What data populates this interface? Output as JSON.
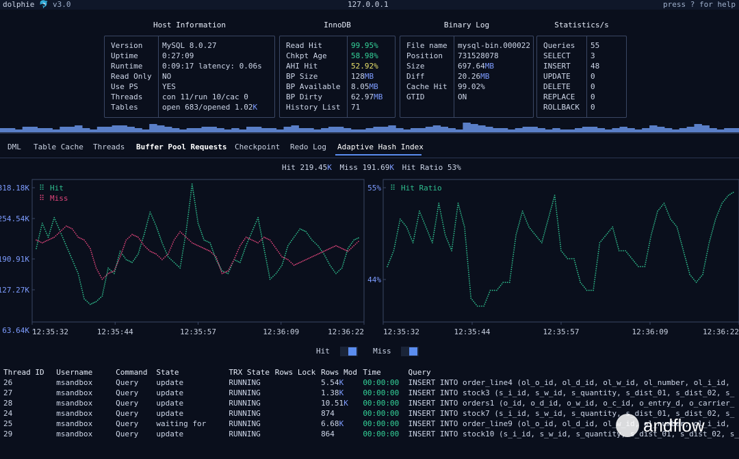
{
  "header": {
    "app": "dolphie",
    "version": "v3.0",
    "host": "127.0.0.1",
    "help": "press ? for help"
  },
  "panels": {
    "host_information": {
      "title": "Host Information",
      "rows": [
        {
          "k": "Version",
          "v": "MySQL 8.0.27"
        },
        {
          "k": "Uptime",
          "v": "0:27:09"
        },
        {
          "k": "Runtime",
          "v": "0:09:17 latency: 0.06s"
        },
        {
          "k": "Read Only",
          "v": "NO"
        },
        {
          "k": "Use PS",
          "v": "YES"
        },
        {
          "k": "Threads",
          "v": "con 11/run 10/cac 0"
        },
        {
          "k": "Tables",
          "v": "open 683/opened 1.02",
          "unit": "K"
        }
      ]
    },
    "innodb": {
      "title": "InnoDB",
      "rows": [
        {
          "k": "Read Hit",
          "v": "99.95%",
          "color": "#34d399"
        },
        {
          "k": "Chkpt Age",
          "v": "58.98%",
          "color": "#34d399"
        },
        {
          "k": "AHI Hit",
          "v": "52.92%",
          "color": "#e8e06a"
        },
        {
          "k": "BP Size",
          "v": "128",
          "unit": "MB"
        },
        {
          "k": "BP Available",
          "v": "8.05",
          "unit": "MB"
        },
        {
          "k": "BP Dirty",
          "v": "62.97",
          "unit": "MB"
        },
        {
          "k": "History List",
          "v": "71"
        }
      ]
    },
    "binary_log": {
      "title": "Binary Log",
      "rows": [
        {
          "k": "File name",
          "v": "mysql-bin.000022"
        },
        {
          "k": "Position",
          "v": "731528078"
        },
        {
          "k": "Size",
          "v": "697.64",
          "unit": "MB"
        },
        {
          "k": "Diff",
          "v": "20.26",
          "unit": "MB"
        },
        {
          "k": "Cache Hit",
          "v": "99.02%"
        },
        {
          "k": "GTID",
          "v": "ON"
        }
      ]
    },
    "statistics": {
      "title": "Statistics/s",
      "rows": [
        {
          "k": "Queries",
          "v": "55"
        },
        {
          "k": "SELECT",
          "v": "3"
        },
        {
          "k": "INSERT",
          "v": "48"
        },
        {
          "k": "UPDATE",
          "v": "0"
        },
        {
          "k": "DELETE",
          "v": "0"
        },
        {
          "k": "REPLACE",
          "v": "0"
        },
        {
          "k": "ROLLBACK",
          "v": "0"
        }
      ]
    }
  },
  "tabs": [
    {
      "label": "DML"
    },
    {
      "label": "Table Cache"
    },
    {
      "label": "Threads"
    },
    {
      "label": "Buffer Pool Requests"
    },
    {
      "label": "Checkpoint"
    },
    {
      "label": "Redo Log"
    },
    {
      "label": "Adaptive Hash Index",
      "active": true
    }
  ],
  "summary": {
    "hit_label": "Hit",
    "hit_value": "219.45",
    "hit_unit": "K",
    "miss_label": "Miss",
    "miss_value": "191.69",
    "miss_unit": "K",
    "ratio_label": "Hit Ratio",
    "ratio_value": "53%"
  },
  "chart_data": [
    {
      "type": "line",
      "x": [
        "12:35:32",
        "12:35:44",
        "12:35:57",
        "12:36:09",
        "12:36:22"
      ],
      "yticks": [
        "318.18K",
        "254.54K",
        "190.91K",
        "127.27K",
        "63.64K"
      ],
      "ylim": [
        63640,
        318180
      ],
      "series": [
        {
          "name": "Hit",
          "color": "#2fbf8f",
          "values": [
            195,
            240,
            215,
            250,
            225,
            200,
            175,
            150,
            105,
            95,
            100,
            110,
            160,
            150,
            190,
            175,
            170,
            185,
            220,
            260,
            235,
            205,
            180,
            170,
            160,
            225,
            310,
            240,
            210,
            205,
            175,
            155,
            150,
            175,
            170,
            200,
            225,
            250,
            195,
            140,
            150,
            165,
            200,
            215,
            230,
            225,
            210,
            200,
            185,
            165,
            150,
            160,
            195,
            210,
            215
          ]
        },
        {
          "name": "Miss",
          "color": "#e0457b",
          "values": [
            210,
            205,
            210,
            215,
            225,
            235,
            230,
            215,
            210,
            195,
            160,
            140,
            150,
            155,
            180,
            210,
            220,
            215,
            200,
            190,
            185,
            175,
            185,
            210,
            225,
            215,
            205,
            200,
            195,
            190,
            180,
            150,
            155,
            175,
            200,
            215,
            210,
            205,
            215,
            210,
            195,
            180,
            175,
            165,
            170,
            175,
            180,
            185,
            190,
            195,
            200,
            195,
            190,
            200,
            210
          ]
        }
      ]
    },
    {
      "type": "line",
      "x": [
        "12:35:32",
        "12:35:44",
        "12:35:57",
        "12:36:09",
        "12:36:22"
      ],
      "yticks": [
        "55%",
        "44%"
      ],
      "ylim": [
        38,
        56
      ],
      "series": [
        {
          "name": "Hit Ratio",
          "color": "#2fbf8f",
          "values": [
            45,
            47,
            51,
            50,
            48,
            52,
            50,
            48,
            53,
            49,
            47,
            53,
            50,
            41,
            40,
            40,
            42,
            42,
            43,
            43,
            49,
            52,
            50,
            49,
            48,
            51,
            54,
            47,
            46,
            46,
            43,
            42,
            42,
            48,
            49,
            50,
            47,
            47,
            46,
            45,
            45,
            49,
            52,
            53,
            51,
            50,
            47,
            44,
            43,
            44,
            48,
            51,
            53,
            54,
            54.5
          ]
        }
      ]
    }
  ],
  "legend": {
    "hit": "Hit",
    "miss": "Miss"
  },
  "threads_table": {
    "columns": [
      "Thread ID",
      "Username",
      "Command",
      "State",
      "TRX State",
      "Rows Lock",
      "Rows Mod",
      "Time",
      "Query"
    ],
    "rows": [
      {
        "id": "26",
        "user": "msandbox",
        "cmd": "Query",
        "state": "update",
        "trx": "RUNNING",
        "lock": "",
        "mod": "5.54",
        "mod_unit": "K",
        "time": "00:00:00",
        "query": "INSERT INTO order_line4 (ol_o_id, ol_d_id, ol_w_id, ol_number, ol_i_id,"
      },
      {
        "id": "27",
        "user": "msandbox",
        "cmd": "Query",
        "state": "update",
        "trx": "RUNNING",
        "lock": "",
        "mod": "1.38",
        "mod_unit": "K",
        "time": "00:00:00",
        "query": "INSERT INTO stock3 (s_i_id, s_w_id, s_quantity, s_dist_01, s_dist_02, s_"
      },
      {
        "id": "28",
        "user": "msandbox",
        "cmd": "Query",
        "state": "update",
        "trx": "RUNNING",
        "lock": "",
        "mod": "10.51",
        "mod_unit": "K",
        "time": "00:00:00",
        "query": "INSERT INTO orders1 (o_id, o_d_id, o_w_id, o_c_id, o_entry_d, o_carrier_"
      },
      {
        "id": "24",
        "user": "msandbox",
        "cmd": "Query",
        "state": "update",
        "trx": "RUNNING",
        "lock": "",
        "mod": "874",
        "mod_unit": "",
        "time": "00:00:00",
        "query": "INSERT INTO stock7 (s_i_id, s_w_id, s_quantity, s_dist_01, s_dist_02, s_"
      },
      {
        "id": "25",
        "user": "msandbox",
        "cmd": "Query",
        "state": "waiting for",
        "trx": "RUNNING",
        "lock": "",
        "mod": "6.68",
        "mod_unit": "K",
        "time": "00:00:00",
        "query": "INSERT INTO order_line9 (ol_o_id, ol_d_id, ol_w_id, ol_number, ol_i_id,"
      },
      {
        "id": "29",
        "user": "msandbox",
        "cmd": "Query",
        "state": "update",
        "trx": "RUNNING",
        "lock": "",
        "mod": "864",
        "mod_unit": "",
        "time": "00:00:00",
        "query": "INSERT INTO stock10 (s_i_id, s_w_id, s_quantity, s_dist_01, s_dist_02, s_"
      }
    ]
  },
  "watermark": "andflow",
  "sparkline": {
    "color": "#5a7fc8",
    "values": [
      3,
      3,
      2,
      4,
      4,
      3,
      3,
      2,
      4,
      4,
      5,
      3,
      2,
      4,
      4,
      5,
      5,
      4,
      3,
      2,
      6,
      5,
      4,
      3,
      2,
      3,
      3,
      4,
      4,
      3,
      2,
      3,
      2,
      4,
      4,
      3,
      3,
      2,
      4,
      5,
      3,
      3,
      2,
      3,
      4,
      4,
      3,
      2,
      2,
      3,
      4,
      4,
      5,
      3,
      2,
      3,
      3,
      4,
      5,
      4,
      3,
      2,
      7,
      6,
      5,
      4,
      3,
      3,
      2,
      3,
      4,
      4,
      3,
      2,
      3,
      2,
      2,
      3,
      4,
      4,
      3,
      2,
      3,
      4,
      3,
      2,
      3,
      5,
      4,
      3,
      2,
      3,
      4,
      6,
      5,
      3,
      2,
      3,
      3
    ]
  }
}
